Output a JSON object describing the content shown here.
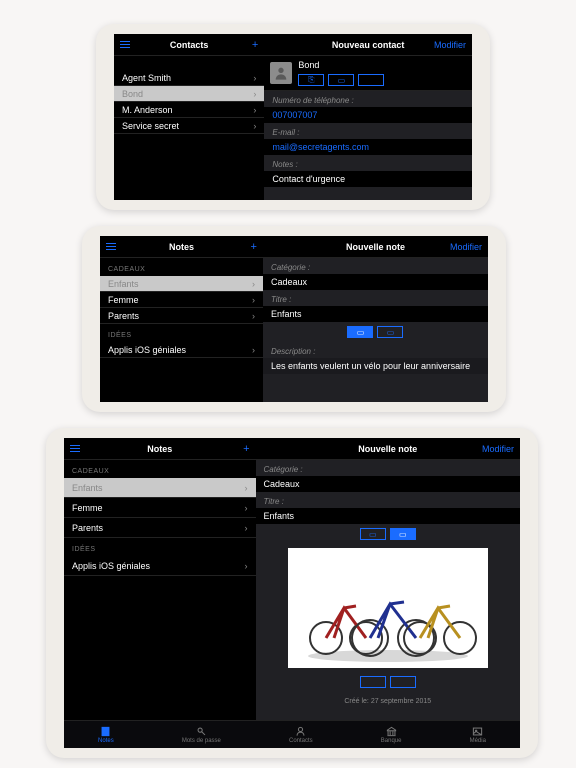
{
  "tablet1": {
    "left_title": "Contacts",
    "right_title": "Nouveau contact",
    "modifier": "Modifier",
    "items": [
      "Agent Smith",
      "Bond",
      "M. Anderson",
      "Service secret"
    ],
    "selected": "Bond",
    "name": "Bond",
    "phone_label": "Numéro de téléphone :",
    "phone": "007007007",
    "email_label": "E-mail :",
    "email": "mail@secretagents.com",
    "notes_label": "Notes :",
    "notes": "Contact d'urgence"
  },
  "tablet2": {
    "left_title": "Notes",
    "right_title": "Nouvelle note",
    "modifier": "Modifier",
    "section1": "CADEAUX",
    "section2": "IDÉES",
    "items1": [
      "Enfants",
      "Femme",
      "Parents"
    ],
    "items2": [
      "Applis iOS géniales"
    ],
    "selected": "Enfants",
    "cat_label": "Catégorie :",
    "cat": "Cadeaux",
    "title_label": "Titre :",
    "title_val": "Enfants",
    "desc_label": "Description :",
    "desc": "Les enfants veulent un vélo pour leur anniversaire"
  },
  "tablet3": {
    "left_title": "Notes",
    "right_title": "Nouvelle note",
    "modifier": "Modifier",
    "section1": "CADEAUX",
    "section2": "IDÉES",
    "items1": [
      "Enfants",
      "Femme",
      "Parents"
    ],
    "items2": [
      "Applis iOS géniales"
    ],
    "selected": "Enfants",
    "cat_label": "Catégorie :",
    "cat": "Cadeaux",
    "title_label": "Titre :",
    "title_val": "Enfants",
    "date": "Créé le: 27 septembre 2015",
    "tabs": [
      "Notes",
      "Mots de passe",
      "Contacts",
      "Banque",
      "Média"
    ]
  }
}
